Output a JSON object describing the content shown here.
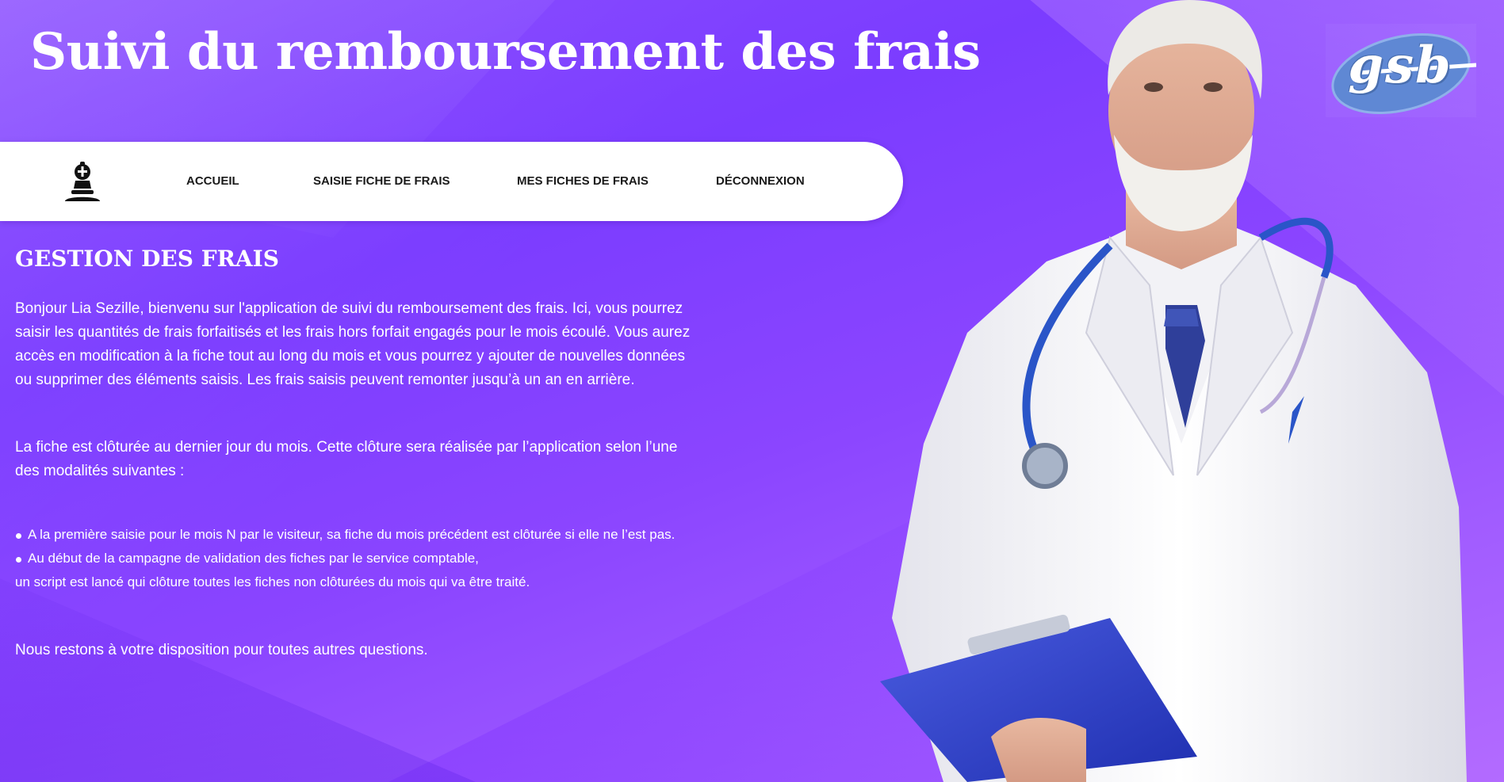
{
  "header": {
    "title": "Suivi du remboursement des frais"
  },
  "nav": {
    "logo_icon": "bishop-icon",
    "items": [
      {
        "label": "ACCUEIL"
      },
      {
        "label": "SAISIE FICHE DE FRAIS"
      },
      {
        "label": "MES FICHES DE FRAIS"
      },
      {
        "label": "DÉCONNEXION"
      }
    ]
  },
  "brand": {
    "logo_text": "gsb"
  },
  "main": {
    "section_title": "GESTION DES FRAIS",
    "intro": "Bonjour Lia Sezille, bienvenu sur l'application de suivi du remboursement des frais. Ici, vous pourrez saisir les quantités de frais forfaitisés et les frais hors forfait engagés pour le mois écoulé. Vous aurez accès en modification à la fiche tout au long du mois et vous pourrez y ajouter de nouvelles données ou supprimer des éléments saisis. Les frais saisis peuvent remonter jusqu’à un an en arrière.",
    "cloture": "La fiche est clôturée au dernier jour du mois. Cette clôture sera réalisée par l’application selon l’une des modalités suivantes :",
    "rules": [
      "A la première saisie pour le mois N par le visiteur, sa fiche du mois précédent est clôturée si elle ne l’est pas.",
      "Au début de la campagne de validation des fiches par le service comptable,"
    ],
    "rule_continuation": "un script est lancé qui clôture toutes les fiches non clôturées du mois qui va être traité.",
    "closing": "Nous restons à votre disposition pour toutes autres questions."
  },
  "colors": {
    "background_primary": "#7b3cff",
    "background_secondary": "#b36bff",
    "navbar": "#ffffff",
    "nav_text": "#1a1a1a",
    "text": "#ffffff"
  }
}
